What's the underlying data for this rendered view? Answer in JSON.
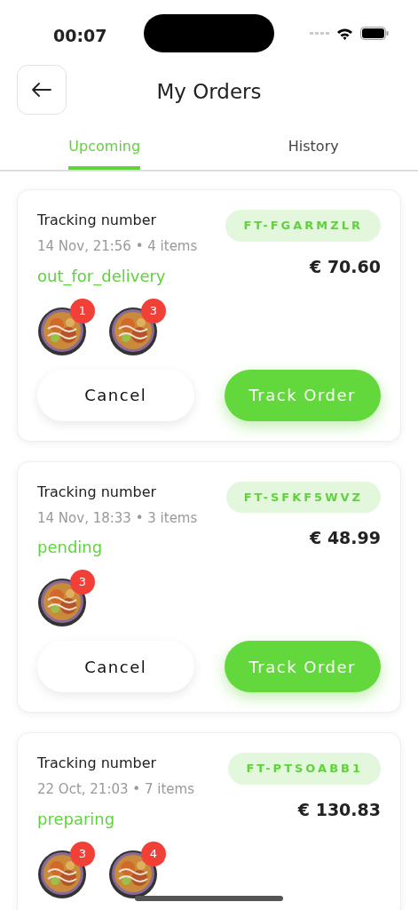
{
  "status_bar": {
    "time": "00:07"
  },
  "header": {
    "title": "My Orders"
  },
  "tabs": [
    {
      "label": "Upcoming",
      "selected": true
    },
    {
      "label": "History",
      "selected": false
    }
  ],
  "orders": [
    {
      "label": "Tracking number",
      "tracking": "FT-FGARMZLR",
      "meta": "14 Nov, 21:56 • 4 items",
      "price": "€ 70.60",
      "status": "out_for_delivery",
      "items": [
        {
          "kind": "picture",
          "count": "1"
        },
        {
          "kind": "picture",
          "count": "3"
        }
      ],
      "actions": [
        {
          "label": "Cancel",
          "kind": "secondary"
        },
        {
          "label": "Track Order",
          "kind": "primary"
        }
      ]
    },
    {
      "label": "Tracking number",
      "tracking": "FT-SFKF5WVZ",
      "meta": "14 Nov, 18:33 • 3 items",
      "price": "€ 48.99",
      "status": "pending",
      "items": [
        {
          "kind": "picture",
          "count": "3"
        }
      ],
      "actions": [
        {
          "label": "Cancel",
          "kind": "secondary"
        },
        {
          "label": "Track Order",
          "kind": "primary"
        }
      ]
    },
    {
      "label": "Tracking number",
      "tracking": "FT-PTSOABB1",
      "meta": "22 Oct, 21:03 • 7 items",
      "price": "€ 130.83",
      "status": "preparing",
      "items": [
        {
          "kind": "picture",
          "count": "3"
        },
        {
          "kind": "picture",
          "count": "4"
        }
      ]
    }
  ]
}
